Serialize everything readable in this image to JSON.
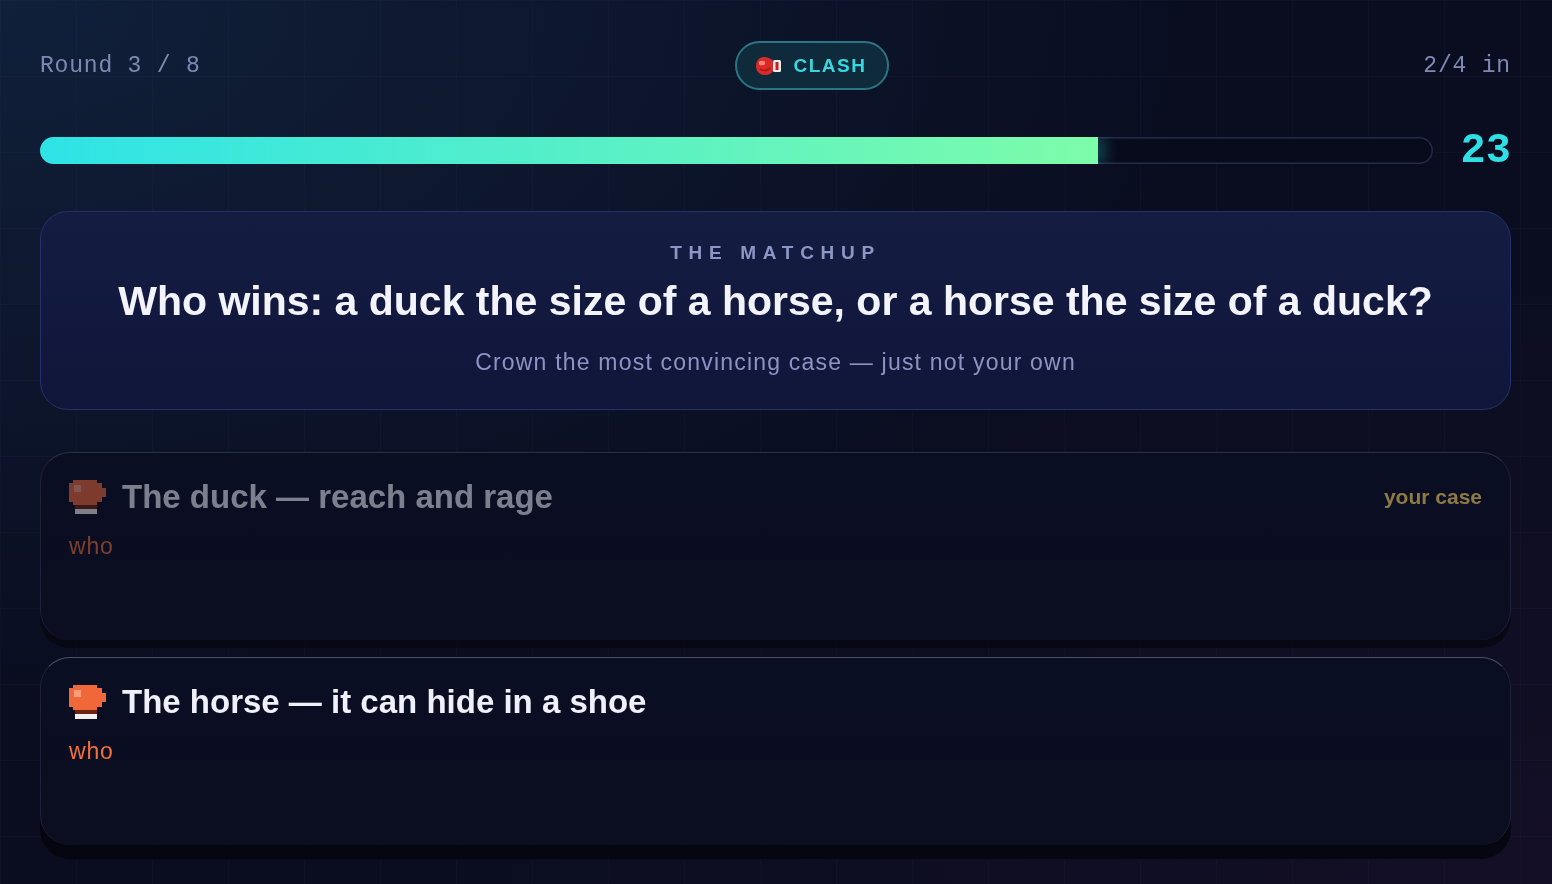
{
  "header": {
    "round": "Round 3 / 8",
    "mode": {
      "label": "CLASH"
    },
    "submitted": "2/4 in"
  },
  "timer": {
    "level": 0.76,
    "seconds": "23"
  },
  "matchup": {
    "eyebrow": "THE MATCHUP",
    "question": "Who wins: a duck the size of a horse, or a horse the size of a duck?",
    "hint": "Crown the most convincing case — just not your own"
  },
  "cases": [
    {
      "title": "The duck — reach and rage",
      "author": "who",
      "own": true,
      "badge": "your case"
    },
    {
      "title": "The horse — it can hide in a shoe",
      "author": "who",
      "own": false
    }
  ]
}
